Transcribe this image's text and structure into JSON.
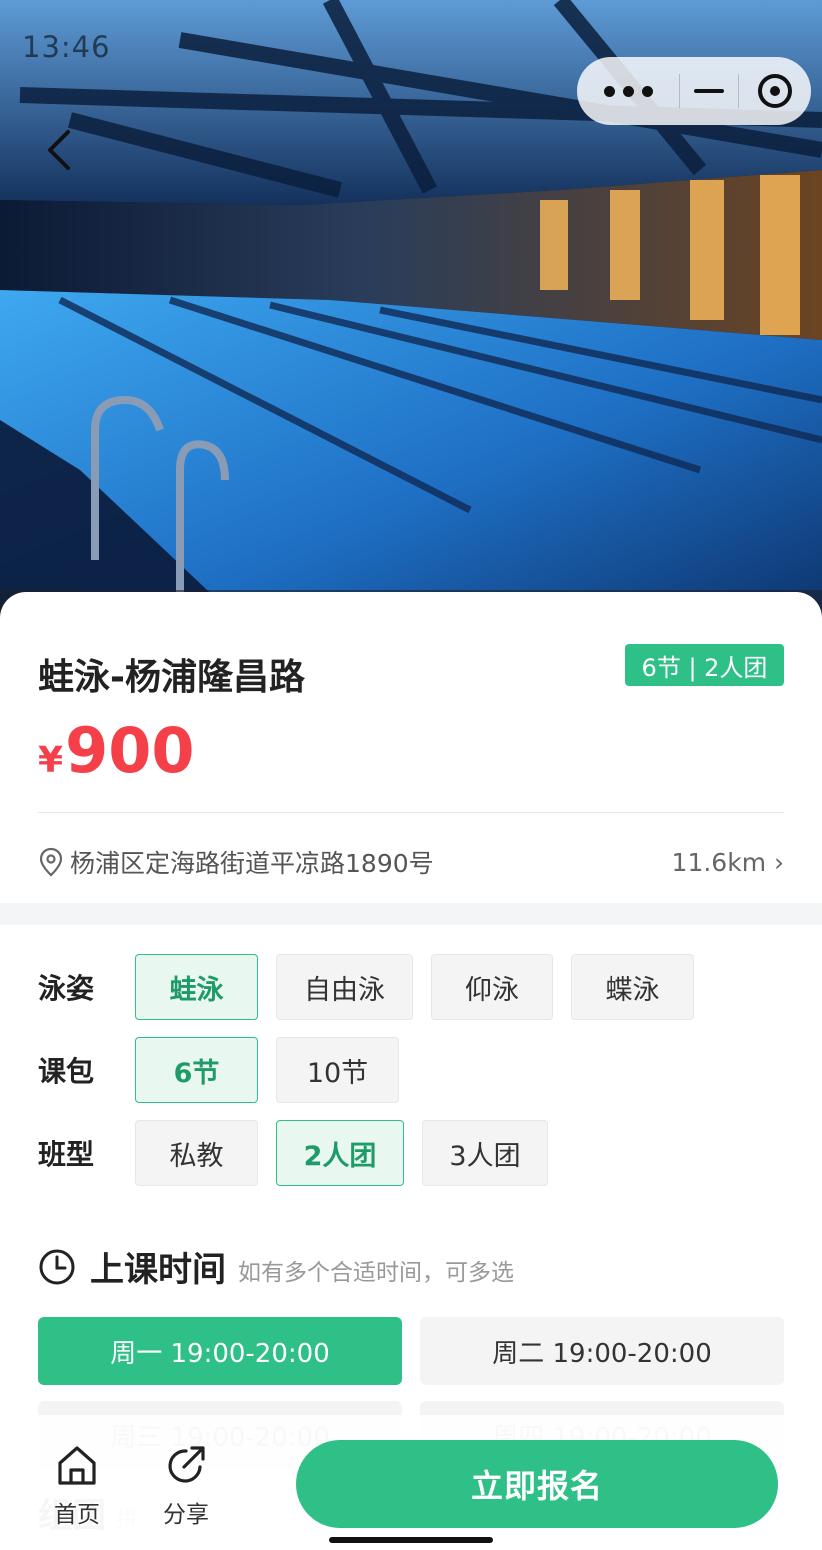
{
  "status_bar": {
    "time": "13:46"
  },
  "hero": {
    "back_icon": "chevron-left-icon",
    "capsule_icons": [
      "more-dots-icon",
      "minimize-icon",
      "close-target-icon"
    ]
  },
  "course": {
    "title": "蛙泳-杨浦隆昌路",
    "badge": "6节 | 2人团",
    "currency": "¥",
    "price": "900",
    "address": "杨浦区定海路街道平凉路1890号",
    "distance": "11.6km ›"
  },
  "options": {
    "stroke": {
      "label": "泳姿",
      "choices": [
        "蛙泳",
        "自由泳",
        "仰泳",
        "蝶泳"
      ],
      "selected": 0
    },
    "package": {
      "label": "课包",
      "choices": [
        "6节",
        "10节"
      ],
      "selected": 0
    },
    "class_type": {
      "label": "班型",
      "choices": [
        "私教",
        "2人团",
        "3人团"
      ],
      "selected": 1
    }
  },
  "schedule": {
    "title": "上课时间",
    "hint": "如有多个合适时间，可多选",
    "slots": [
      "周一 19:00-20:00",
      "周二 19:00-20:00",
      "周三 19:00-20:00",
      "周四 19:00-20:00"
    ],
    "selected": 0
  },
  "peek_section": {
    "title": "组团",
    "hint": "拼"
  },
  "bottom_bar": {
    "home_label": "首页",
    "share_label": "分享",
    "signup_label": "立即报名"
  },
  "colors": {
    "accent": "#2fc087",
    "price": "#f5404a"
  }
}
